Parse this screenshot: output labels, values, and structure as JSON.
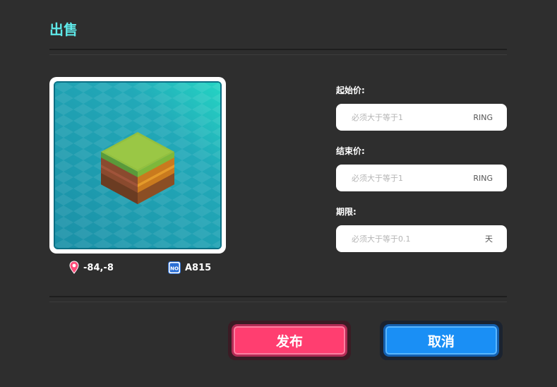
{
  "header": {
    "title": "出售"
  },
  "land": {
    "coordinates": "-84,-8",
    "number": "A815",
    "number_badge": "NO"
  },
  "form": {
    "start_price": {
      "label": "起始价:",
      "placeholder": "必须大于等于1",
      "unit": "RING"
    },
    "end_price": {
      "label": "结束价:",
      "placeholder": "必须大于等于1",
      "unit": "RING"
    },
    "duration": {
      "label": "期限:",
      "placeholder": "必须大于等于0.1",
      "unit": "天"
    }
  },
  "actions": {
    "publish_label": "发布",
    "cancel_label": "取消"
  },
  "colors": {
    "accent_title": "#5ee8e8",
    "publish": "#ff3e70",
    "cancel": "#1a8ff5",
    "background": "#2e2e2e"
  },
  "icons": {
    "location": "location-pin-icon",
    "number": "number-badge-icon"
  }
}
